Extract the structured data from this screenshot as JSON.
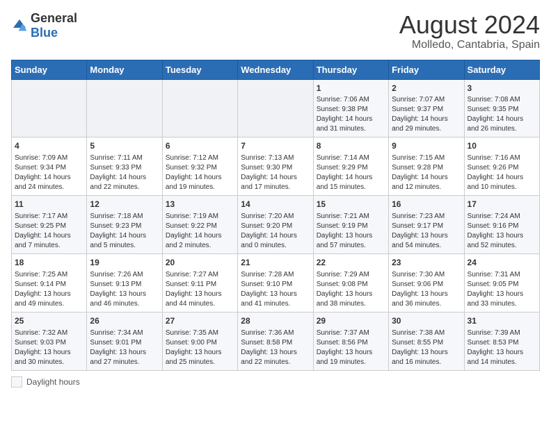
{
  "header": {
    "logo_general": "General",
    "logo_blue": "Blue",
    "title": "August 2024",
    "subtitle": "Molledo, Cantabria, Spain"
  },
  "days_of_week": [
    "Sunday",
    "Monday",
    "Tuesday",
    "Wednesday",
    "Thursday",
    "Friday",
    "Saturday"
  ],
  "weeks": [
    [
      {
        "day": "",
        "info": ""
      },
      {
        "day": "",
        "info": ""
      },
      {
        "day": "",
        "info": ""
      },
      {
        "day": "",
        "info": ""
      },
      {
        "day": "1",
        "info": "Sunrise: 7:06 AM\nSunset: 9:38 PM\nDaylight: 14 hours\nand 31 minutes."
      },
      {
        "day": "2",
        "info": "Sunrise: 7:07 AM\nSunset: 9:37 PM\nDaylight: 14 hours\nand 29 minutes."
      },
      {
        "day": "3",
        "info": "Sunrise: 7:08 AM\nSunset: 9:35 PM\nDaylight: 14 hours\nand 26 minutes."
      }
    ],
    [
      {
        "day": "4",
        "info": "Sunrise: 7:09 AM\nSunset: 9:34 PM\nDaylight: 14 hours\nand 24 minutes."
      },
      {
        "day": "5",
        "info": "Sunrise: 7:11 AM\nSunset: 9:33 PM\nDaylight: 14 hours\nand 22 minutes."
      },
      {
        "day": "6",
        "info": "Sunrise: 7:12 AM\nSunset: 9:32 PM\nDaylight: 14 hours\nand 19 minutes."
      },
      {
        "day": "7",
        "info": "Sunrise: 7:13 AM\nSunset: 9:30 PM\nDaylight: 14 hours\nand 17 minutes."
      },
      {
        "day": "8",
        "info": "Sunrise: 7:14 AM\nSunset: 9:29 PM\nDaylight: 14 hours\nand 15 minutes."
      },
      {
        "day": "9",
        "info": "Sunrise: 7:15 AM\nSunset: 9:28 PM\nDaylight: 14 hours\nand 12 minutes."
      },
      {
        "day": "10",
        "info": "Sunrise: 7:16 AM\nSunset: 9:26 PM\nDaylight: 14 hours\nand 10 minutes."
      }
    ],
    [
      {
        "day": "11",
        "info": "Sunrise: 7:17 AM\nSunset: 9:25 PM\nDaylight: 14 hours\nand 7 minutes."
      },
      {
        "day": "12",
        "info": "Sunrise: 7:18 AM\nSunset: 9:23 PM\nDaylight: 14 hours\nand 5 minutes."
      },
      {
        "day": "13",
        "info": "Sunrise: 7:19 AM\nSunset: 9:22 PM\nDaylight: 14 hours\nand 2 minutes."
      },
      {
        "day": "14",
        "info": "Sunrise: 7:20 AM\nSunset: 9:20 PM\nDaylight: 14 hours\nand 0 minutes."
      },
      {
        "day": "15",
        "info": "Sunrise: 7:21 AM\nSunset: 9:19 PM\nDaylight: 13 hours\nand 57 minutes."
      },
      {
        "day": "16",
        "info": "Sunrise: 7:23 AM\nSunset: 9:17 PM\nDaylight: 13 hours\nand 54 minutes."
      },
      {
        "day": "17",
        "info": "Sunrise: 7:24 AM\nSunset: 9:16 PM\nDaylight: 13 hours\nand 52 minutes."
      }
    ],
    [
      {
        "day": "18",
        "info": "Sunrise: 7:25 AM\nSunset: 9:14 PM\nDaylight: 13 hours\nand 49 minutes."
      },
      {
        "day": "19",
        "info": "Sunrise: 7:26 AM\nSunset: 9:13 PM\nDaylight: 13 hours\nand 46 minutes."
      },
      {
        "day": "20",
        "info": "Sunrise: 7:27 AM\nSunset: 9:11 PM\nDaylight: 13 hours\nand 44 minutes."
      },
      {
        "day": "21",
        "info": "Sunrise: 7:28 AM\nSunset: 9:10 PM\nDaylight: 13 hours\nand 41 minutes."
      },
      {
        "day": "22",
        "info": "Sunrise: 7:29 AM\nSunset: 9:08 PM\nDaylight: 13 hours\nand 38 minutes."
      },
      {
        "day": "23",
        "info": "Sunrise: 7:30 AM\nSunset: 9:06 PM\nDaylight: 13 hours\nand 36 minutes."
      },
      {
        "day": "24",
        "info": "Sunrise: 7:31 AM\nSunset: 9:05 PM\nDaylight: 13 hours\nand 33 minutes."
      }
    ],
    [
      {
        "day": "25",
        "info": "Sunrise: 7:32 AM\nSunset: 9:03 PM\nDaylight: 13 hours\nand 30 minutes."
      },
      {
        "day": "26",
        "info": "Sunrise: 7:34 AM\nSunset: 9:01 PM\nDaylight: 13 hours\nand 27 minutes."
      },
      {
        "day": "27",
        "info": "Sunrise: 7:35 AM\nSunset: 9:00 PM\nDaylight: 13 hours\nand 25 minutes."
      },
      {
        "day": "28",
        "info": "Sunrise: 7:36 AM\nSunset: 8:58 PM\nDaylight: 13 hours\nand 22 minutes."
      },
      {
        "day": "29",
        "info": "Sunrise: 7:37 AM\nSunset: 8:56 PM\nDaylight: 13 hours\nand 19 minutes."
      },
      {
        "day": "30",
        "info": "Sunrise: 7:38 AM\nSunset: 8:55 PM\nDaylight: 13 hours\nand 16 minutes."
      },
      {
        "day": "31",
        "info": "Sunrise: 7:39 AM\nSunset: 8:53 PM\nDaylight: 13 hours\nand 14 minutes."
      }
    ]
  ],
  "legend": {
    "box_label": "Daylight hours"
  },
  "colors": {
    "header_bg": "#2a6db5",
    "accent": "#2a6db5"
  }
}
